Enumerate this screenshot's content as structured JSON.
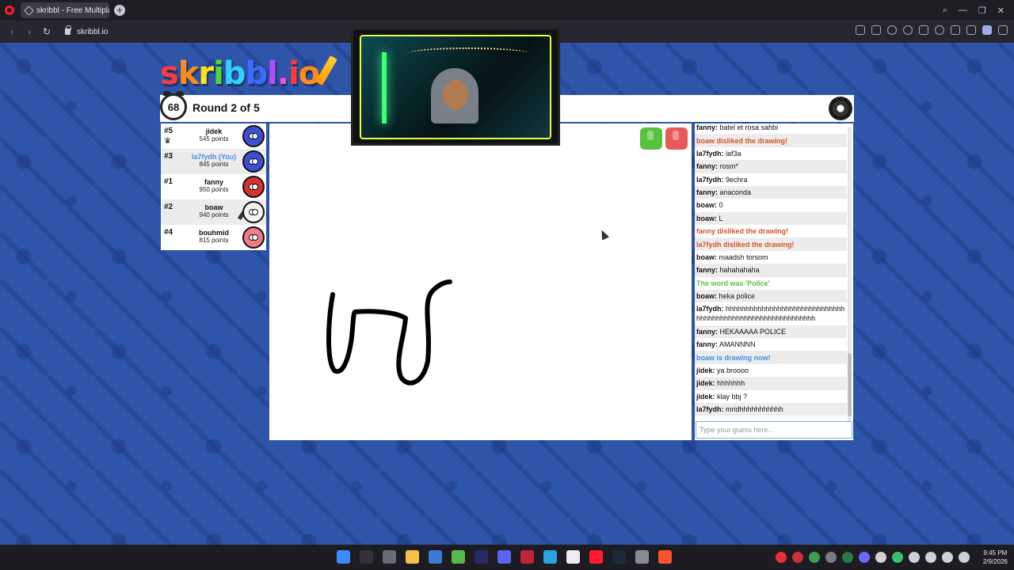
{
  "browser": {
    "tab_title": "skribbl - Free Multiplayer",
    "new_tab": "+",
    "url": "skribbl.io",
    "nav_back": "‹",
    "nav_forward": "›",
    "reload": "↻"
  },
  "window_controls": {
    "search": "⌕",
    "minimize": "—",
    "maximize": "❐",
    "close": "✕"
  },
  "logo": {
    "parts": [
      "s",
      "k",
      "r",
      "i",
      "b",
      "b",
      "l",
      ".",
      "i",
      "o"
    ],
    "colors": [
      "#ff3b3b",
      "#ff8c1a",
      "#ffe11a",
      "#4cd83b",
      "#2fd1ff",
      "#3b6bff",
      "#b54bff",
      "#ff4bc8",
      "#ff3b3b",
      "#ff8c1a"
    ],
    "suffix": "!"
  },
  "game": {
    "timer": "68",
    "round_label": "Round 2 of 5"
  },
  "players": [
    {
      "rank": "#5",
      "name": "jidek",
      "points": "545 points",
      "avatar_color": "#3f4ed8",
      "you": false,
      "crown": true
    },
    {
      "rank": "#3",
      "name": "la7fydh (You)",
      "points": "845 points",
      "avatar_color": "#3f4ed8",
      "you": true,
      "crown": false
    },
    {
      "rank": "#1",
      "name": "fanny",
      "points": "950 points",
      "avatar_color": "#d83232",
      "you": false,
      "crown": false
    },
    {
      "rank": "#2",
      "name": "boaw",
      "points": "940 points",
      "avatar_color": "#f2f2f2",
      "you": false,
      "crown": false,
      "drawing": true
    },
    {
      "rank": "#4",
      "name": "bouhmid",
      "points": "815 points",
      "avatar_color": "#f07a8a",
      "you": false,
      "crown": false
    }
  ],
  "chat": [
    {
      "user": "fanny:",
      "text": "batel et rosa sahbi",
      "style": "normal"
    },
    {
      "user": "",
      "text": "boaw disliked the drawing!",
      "style": "sys-red"
    },
    {
      "user": "la7fydh:",
      "text": "laf3a",
      "style": "normal"
    },
    {
      "user": "fanny:",
      "text": "rosm*",
      "style": "normal"
    },
    {
      "user": "la7fydh:",
      "text": "9echra",
      "style": "normal"
    },
    {
      "user": "fanny:",
      "text": "anaconda",
      "style": "normal"
    },
    {
      "user": "boaw:",
      "text": "0",
      "style": "normal"
    },
    {
      "user": "boaw:",
      "text": "L",
      "style": "normal"
    },
    {
      "user": "",
      "text": "fanny disliked the drawing!",
      "style": "sys-red"
    },
    {
      "user": "",
      "text": "la7fydh disliked the drawing!",
      "style": "sys-red"
    },
    {
      "user": "boaw:",
      "text": "maadsh torsom",
      "style": "normal"
    },
    {
      "user": "fanny:",
      "text": "hahahahaha",
      "style": "normal"
    },
    {
      "user": "",
      "text": "The word was 'Police'",
      "style": "sys-green"
    },
    {
      "user": "boaw:",
      "text": "heka police",
      "style": "normal"
    },
    {
      "user": "la7fydh:",
      "text": "hhhhhhhhhhhhhhhhhhhhhhhhhhhhhhhhhhhhhhhhhhhhhhhhhhhhhhhhhhhh",
      "style": "normal"
    },
    {
      "user": "fanny:",
      "text": "HEKAAAAA POLICE",
      "style": "normal"
    },
    {
      "user": "fanny:",
      "text": "AMANNNN",
      "style": "normal"
    },
    {
      "user": "",
      "text": "boaw is drawing now!",
      "style": "sys-blue"
    },
    {
      "user": "jidek:",
      "text": "ya broooo",
      "style": "normal"
    },
    {
      "user": "jidek:",
      "text": "hhhhhhh",
      "style": "normal"
    },
    {
      "user": "jidek:",
      "text": "klay bbj ?",
      "style": "normal"
    },
    {
      "user": "la7fydh:",
      "text": "mridhhhhhhhhhhh",
      "style": "normal"
    }
  ],
  "guess_input": {
    "placeholder": "Type your guess here...",
    "value": ""
  },
  "taskbar": {
    "icons": [
      "windows-start",
      "epic-games",
      "davinci",
      "file-explorer",
      "app-l",
      "xbox",
      "premiere",
      "discord",
      "vivaldi",
      "telegram",
      "obs",
      "opera",
      "steam",
      "steam-2",
      "brave"
    ],
    "icon_colors": [
      "#3b8bff",
      "#333333",
      "#6a6a78",
      "#f2c24a",
      "#3c7bd6",
      "#57b947",
      "#2a2a6a",
      "#5865f2",
      "#c0243a",
      "#2aa3e0",
      "#ededed",
      "#ff1b2d",
      "#1b2838",
      "#8a8a96",
      "#fb542b"
    ],
    "tray_colors": [
      "#e8303a",
      "#d0303a",
      "#3aa050",
      "#7a7a86",
      "#2a7a44",
      "#6a6aff",
      "#cfcfd8",
      "#37c26a",
      "#cfcfd8",
      "#cfcfd8",
      "#cfcfd8",
      "#cfcfd8"
    ],
    "time": "9:45 PM",
    "date": "2/9/2026"
  }
}
